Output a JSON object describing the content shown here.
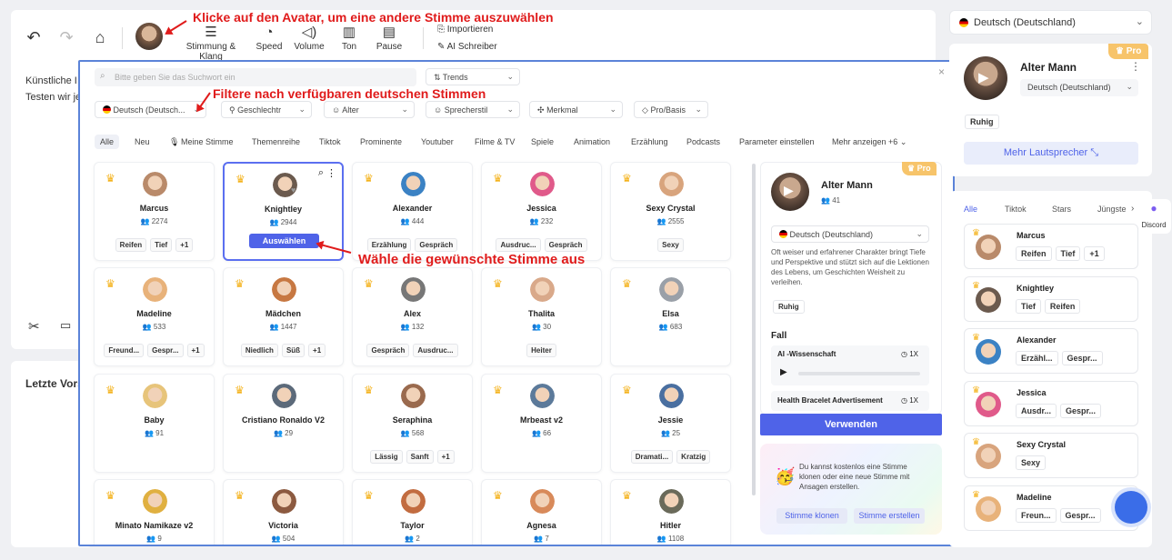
{
  "toolbar": {
    "items": [
      {
        "label": "Stimmung & Klang",
        "icon": "sliders-icon"
      },
      {
        "label": "Speed",
        "icon": "speed-icon"
      },
      {
        "label": "Volume",
        "icon": "volume-icon"
      },
      {
        "label": "Ton",
        "icon": "tone-icon"
      },
      {
        "label": "Pause",
        "icon": "pause-icon"
      }
    ],
    "import_label": "Importieren",
    "ai_writer_label": "AI Schreiber"
  },
  "editor": {
    "line1": "Künstliche I",
    "line2": "Testen wir je",
    "recent_label": "Letzte Vors"
  },
  "annotations": {
    "avatar_hint": "Klicke auf den Avatar, um eine andere Stimme auszuwählen",
    "filter_hint": "Filtere nach verfügbaren deutschen Stimmen",
    "select_hint": "Wähle die gewünschte Stimme aus"
  },
  "modal": {
    "search_placeholder": "Bitte geben Sie das Suchwort ein",
    "sort_label": "Trends",
    "filters": {
      "language": "Deutsch (Deutsch...",
      "gender": "Geschlechtr",
      "age": "Alter",
      "style": "Sprecherstil",
      "feature": "Merkmal",
      "plan": "Pro/Basis"
    },
    "tabs": [
      "Alle",
      "Neu",
      "Meine Stimme",
      "Themenreihe",
      "Tiktok",
      "Prominente",
      "Youtuber",
      "Filme & TV",
      "Spiele",
      "Animation",
      "Erzählung",
      "Podcasts",
      "Parameter einstellen",
      "Mehr anzeigen +6"
    ],
    "select_button": "Auswählen",
    "voices": [
      {
        "name": "Marcus",
        "count": "2274",
        "tags": [
          "Reifen",
          "Tief",
          "+1"
        ]
      },
      {
        "name": "Knightley",
        "count": "2944",
        "tags": []
      },
      {
        "name": "Alexander",
        "count": "444",
        "tags": [
          "Erzählung",
          "Gespräch"
        ]
      },
      {
        "name": "Jessica",
        "count": "232",
        "tags": [
          "Ausdruc...",
          "Gespräch"
        ]
      },
      {
        "name": "Sexy Crystal",
        "count": "2555",
        "tags": [
          "Sexy"
        ]
      },
      {
        "name": "Madeline",
        "count": "533",
        "tags": [
          "Freund...",
          "Gespr...",
          "+1"
        ]
      },
      {
        "name": "Mädchen",
        "count": "1447",
        "tags": [
          "Niedlich",
          "Süß",
          "+1"
        ]
      },
      {
        "name": "Alex",
        "count": "132",
        "tags": [
          "Gespräch",
          "Ausdruc..."
        ]
      },
      {
        "name": "Thalita",
        "count": "30",
        "tags": [
          "Heiter"
        ]
      },
      {
        "name": "Elsa",
        "count": "683",
        "tags": []
      },
      {
        "name": "Baby",
        "count": "91",
        "tags": []
      },
      {
        "name": "Cristiano Ronaldo V2",
        "count": "29",
        "tags": []
      },
      {
        "name": "Seraphina",
        "count": "568",
        "tags": [
          "Lässig",
          "Sanft",
          "+1"
        ]
      },
      {
        "name": "Mrbeast v2",
        "count": "66",
        "tags": []
      },
      {
        "name": "Jessie",
        "count": "25",
        "tags": [
          "Dramati...",
          "Kratzig"
        ]
      },
      {
        "name": "Minato Namikaze v2",
        "count": "9",
        "tags": []
      },
      {
        "name": "Victoria",
        "count": "504",
        "tags": []
      },
      {
        "name": "Taylor",
        "count": "2",
        "tags": []
      },
      {
        "name": "Agnesa",
        "count": "7",
        "tags": []
      },
      {
        "name": "Hitler",
        "count": "1108",
        "tags": []
      }
    ],
    "detail": {
      "pro": "Pro",
      "name": "Alter Mann",
      "count": "41",
      "language": "Deutsch (Deutschland)",
      "description": "Oft weiser und erfahrener Charakter bringt Tiefe und Perspektive und stützt sich auf die Lektionen des Lebens, um Geschichten Weisheit zu verleihen.",
      "tag": "Ruhig",
      "case_heading": "Fall",
      "case1": "AI -Wissenschaft",
      "case2": "Health Bracelet Advertisement",
      "speed1": "1X",
      "speed2": "1X",
      "use_button": "Verwenden",
      "promo": "Du kannst kostenlos eine Stimme klonen oder eine neue Stimme mit Ansagen erstellen.",
      "clone_button": "Stimme klonen",
      "create_button": "Stimme erstellen"
    }
  },
  "sidebar": {
    "language": "Deutsch (Deutschland)",
    "current": {
      "pro": "Pro",
      "name": "Alter Mann",
      "language": "Deutsch (Deutschland)",
      "tag": "Ruhig",
      "more_button": "Mehr Lautsprecher"
    },
    "tabs": [
      "Alle",
      "Tiktok",
      "Stars",
      "Jüngste"
    ],
    "discord_label": "Discord",
    "voices": [
      {
        "name": "Marcus",
        "tags": [
          "Reifen",
          "Tief",
          "+1"
        ]
      },
      {
        "name": "Knightley",
        "tags": [
          "Tief",
          "Reifen"
        ]
      },
      {
        "name": "Alexander",
        "tags": [
          "Erzähl...",
          "Gespr..."
        ]
      },
      {
        "name": "Jessica",
        "tags": [
          "Ausdr...",
          "Gespr..."
        ]
      },
      {
        "name": "Sexy Crystal",
        "tags": [
          "Sexy"
        ]
      },
      {
        "name": "Madeline",
        "tags": [
          "Freun...",
          "Gespr..."
        ]
      }
    ]
  }
}
